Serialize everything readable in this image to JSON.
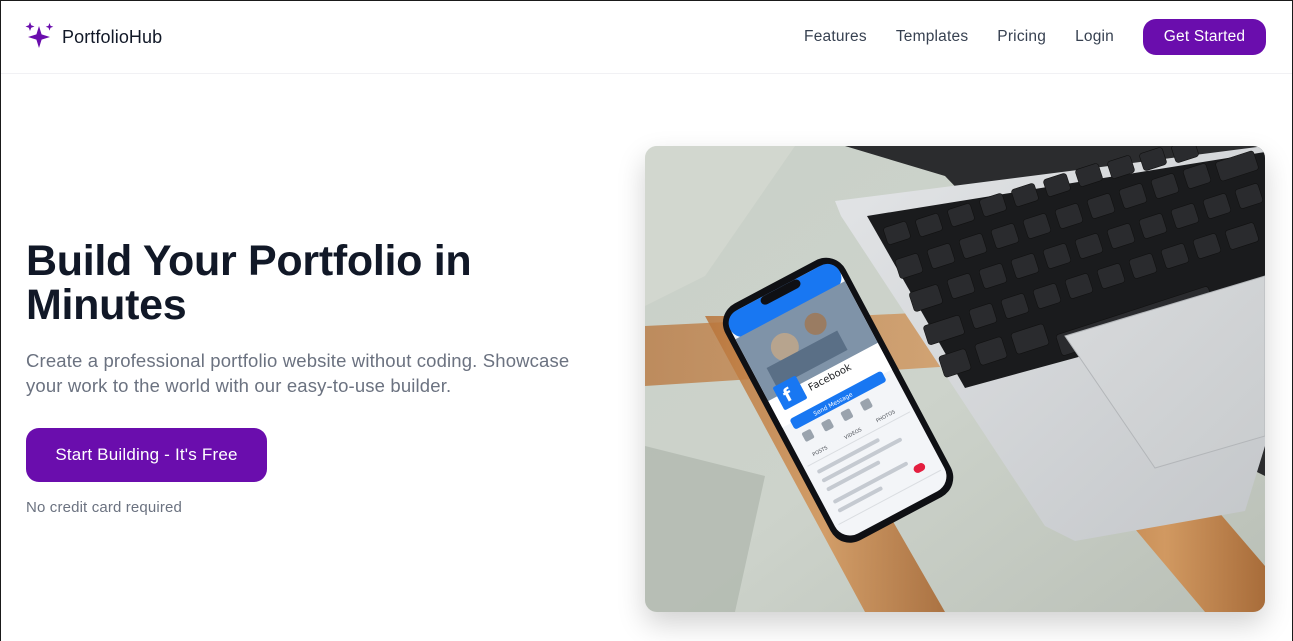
{
  "brand": {
    "name": "PortfolioHub",
    "logo_icon": "sparkles-icon",
    "accent": "#6a0dad"
  },
  "nav": {
    "links": [
      "Features",
      "Templates",
      "Pricing",
      "Login"
    ],
    "cta": "Get Started"
  },
  "hero": {
    "title": "Build Your Portfolio in Minutes",
    "subtitle": "Create a professional portfolio website without coding. Showcase your work to the world with our easy-to-use builder.",
    "cta": "Start Building - It's Free",
    "note": "No credit card required",
    "image": {
      "phone_app": "Facebook",
      "phone_button": "Send Message",
      "phone_tabs": [
        "POSTS",
        "VIDEOS",
        "PHOTOS"
      ]
    }
  },
  "colors": {
    "primary": "#6a0dad",
    "heading": "#111827",
    "muted": "#6b7280"
  }
}
